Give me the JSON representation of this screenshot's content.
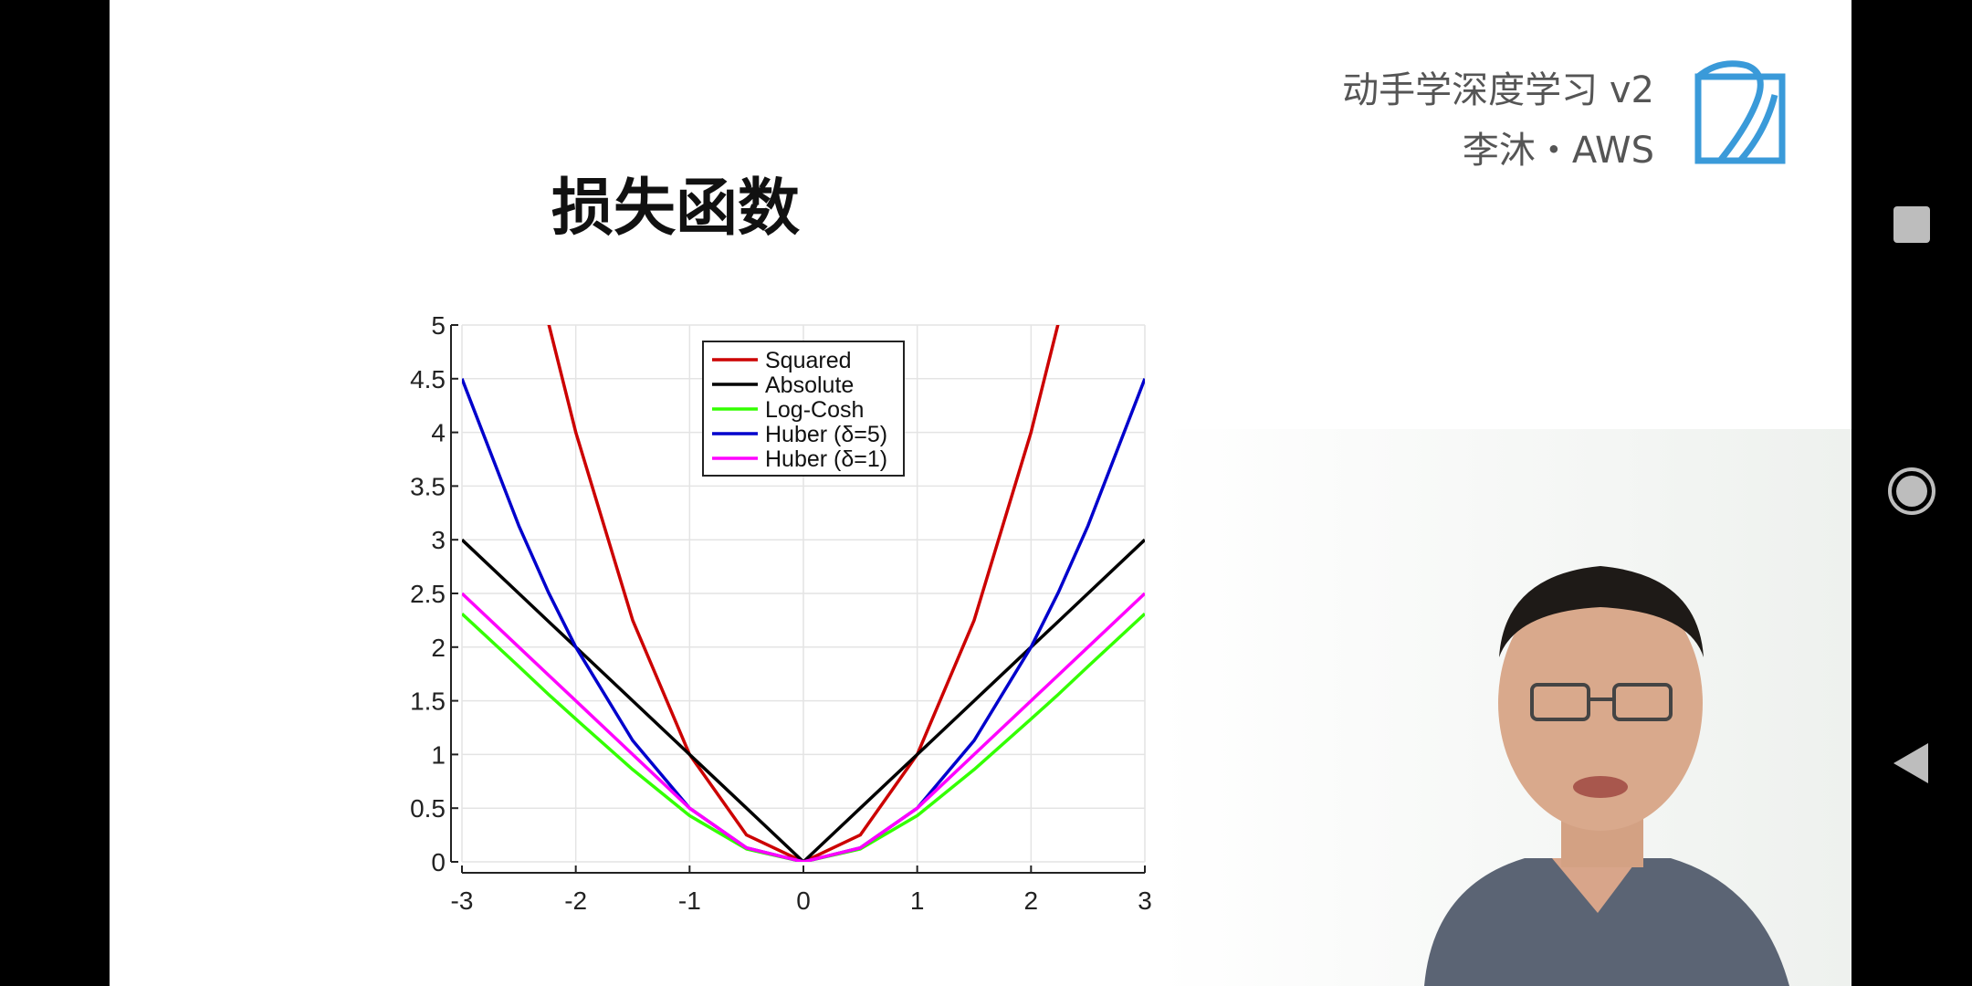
{
  "header": {
    "course_line1": "动手学深度学习 v2",
    "course_line2": "李沐・AWS",
    "logo_icon": "d2l-book-logo-icon",
    "logo_color": "#3a9ad9"
  },
  "slide": {
    "title": "损失函数"
  },
  "chart_data": {
    "type": "line",
    "title": "",
    "xlabel": "",
    "ylabel": "",
    "xlim": [
      -3,
      3
    ],
    "ylim": [
      0,
      5
    ],
    "xticks": [
      "-3",
      "-2",
      "-1",
      "0",
      "1",
      "2",
      "3"
    ],
    "yticks": [
      "0",
      "0.5",
      "1",
      "1.5",
      "2",
      "2.5",
      "3",
      "3.5",
      "4",
      "4.5",
      "5"
    ],
    "grid": true,
    "legend_position": "top-center",
    "x": [
      -3,
      -2.5,
      -2.24,
      -2,
      -1.5,
      -1,
      -0.5,
      0,
      0.5,
      1,
      1.5,
      2,
      2.24,
      2.5,
      3
    ],
    "series": [
      {
        "name": "Squared",
        "color": "#cc0000",
        "values": [
          null,
          null,
          5.02,
          4,
          2.25,
          1,
          0.25,
          0,
          0.25,
          1,
          2.25,
          4,
          5.02,
          null,
          null
        ]
      },
      {
        "name": "Absolute",
        "color": "#000000",
        "values": [
          3,
          2.5,
          2.24,
          2,
          1.5,
          1,
          0.5,
          0,
          0.5,
          1,
          1.5,
          2,
          2.24,
          2.5,
          3
        ]
      },
      {
        "name": "Log-Cosh",
        "color": "#33ff00",
        "values": [
          2.31,
          1.82,
          1.56,
          1.33,
          0.86,
          0.43,
          0.12,
          0,
          0.12,
          0.43,
          0.86,
          1.33,
          1.56,
          1.82,
          2.31
        ]
      },
      {
        "name": "Huber (δ=5)",
        "color": "#0000cc",
        "values": [
          4.5,
          3.13,
          2.51,
          2,
          1.13,
          0.5,
          0.13,
          0,
          0.13,
          0.5,
          1.13,
          2,
          2.51,
          3.13,
          4.5
        ]
      },
      {
        "name": "Huber (δ=1)",
        "color": "#ff00ff",
        "values": [
          2.5,
          2,
          1.74,
          1.5,
          1,
          0.5,
          0.13,
          0,
          0.13,
          0.5,
          1,
          1.5,
          1.74,
          2,
          2.5
        ]
      }
    ]
  },
  "nav": {
    "recent_icon": "square-icon",
    "home_icon": "circle-icon",
    "back_icon": "triangle-back-icon"
  }
}
